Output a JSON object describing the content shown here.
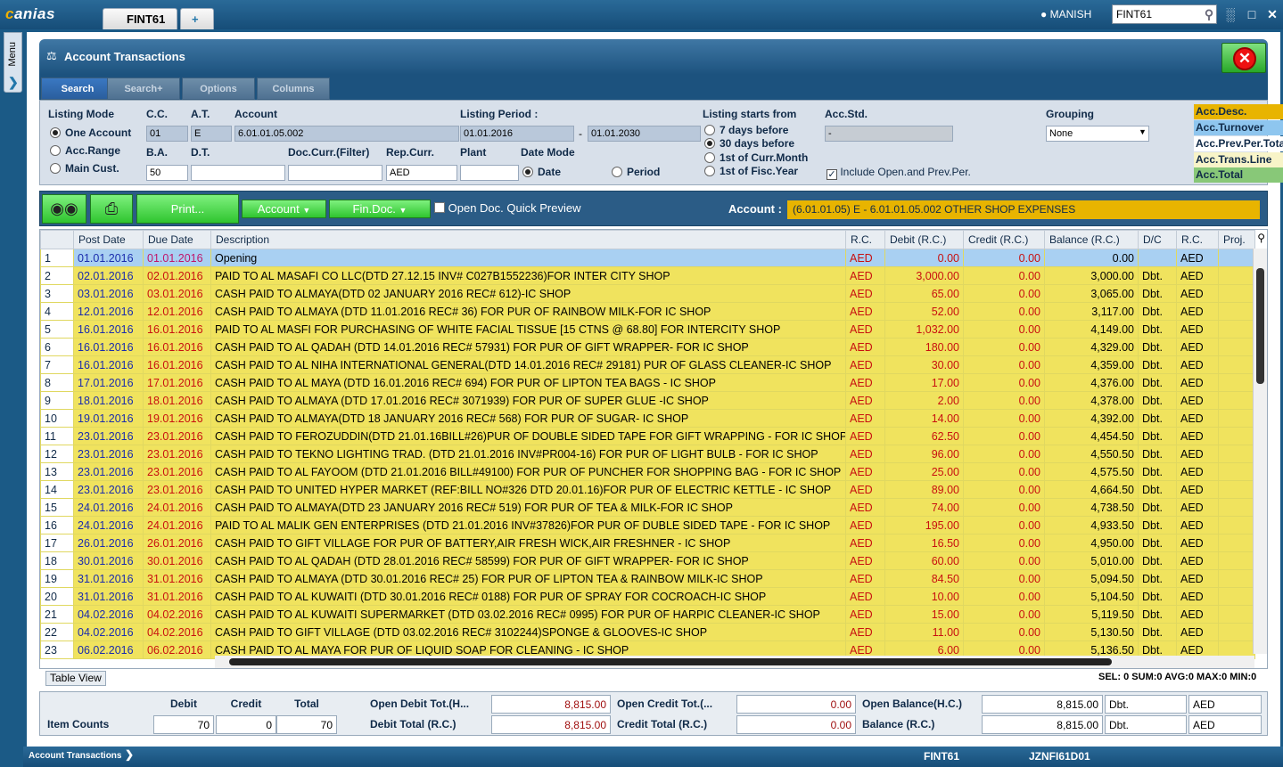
{
  "app": {
    "logo_prefix": "c",
    "logo_rest": "anias",
    "tab_title": "FINT61",
    "tab_new": "+",
    "user": "MANISH",
    "top_search_value": "FINT61"
  },
  "menu": {
    "label": "Menu"
  },
  "panel": {
    "title": "Account Transactions"
  },
  "subtabs": [
    "Search",
    "Search+",
    "Options",
    "Columns"
  ],
  "search": {
    "listing_mode_label": "Listing Mode",
    "radio_one_account": "One Account",
    "radio_acc_range": "Acc.Range",
    "radio_main_cust": "Main Cust.",
    "cc_label": "C.C.",
    "cc_value": "01",
    "at_label": "A.T.",
    "at_value": "E",
    "account_label": "Account",
    "account_value": "6.01.01.05.002",
    "listing_period_label": "Listing Period :",
    "period_from": "01.01.2016",
    "period_dash": "-",
    "period_to": "01.01.2030",
    "listing_starts_label": "Listing starts from",
    "ls_7": "7 days before",
    "ls_30": "30 days before",
    "ls_curr": "1st of Curr.Month",
    "ls_fisc": "1st of Fisc.Year",
    "accstd_label": "Acc.Std.",
    "accstd_value": "-",
    "grouping_label": "Grouping",
    "grouping_value": "None",
    "ba_label": "B.A.",
    "ba_value": "50",
    "dt_label": "D.T.",
    "doccurr_label": "Doc.Curr.(Filter)",
    "repcurr_label": "Rep.Curr.",
    "repcurr_value": "AED",
    "plant_label": "Plant",
    "datemode_label": "Date Mode",
    "dm_date": "Date",
    "dm_period": "Period",
    "include_label": "Include Open.and Prev.Per."
  },
  "legend": [
    {
      "label": "Acc.Desc.",
      "color": "#e8b400"
    },
    {
      "label": "Acc.Turnover",
      "color": "#8ec6ef"
    },
    {
      "label": "Acc.Prev.Per.Total",
      "color": "#ffffff"
    },
    {
      "label": "Acc.Trans.Line",
      "color": "#f8f4c8"
    },
    {
      "label": "Acc.Total",
      "color": "#88c878"
    }
  ],
  "toolbar": {
    "print_label": "Print...",
    "account_dd": "Account",
    "findoc_dd": "Fin.Doc.",
    "quick_preview": "Open Doc. Quick Preview",
    "account_label": "Account :",
    "account_info": "(6.01.01.05)  E - 6.01.01.05.002   OTHER SHOP EXPENSES"
  },
  "grid": {
    "columns": [
      "",
      "Post Date",
      "Due Date",
      "Description",
      "R.C.",
      "Debit (R.C.)",
      "Credit (R.C.)",
      "Balance (R.C.)",
      "D/C",
      "R.C.",
      "Proj."
    ],
    "rows": [
      [
        "1",
        "01.01.2016",
        "01.01.2016",
        "Opening",
        "AED",
        "0.00",
        "0.00",
        "0.00",
        "",
        "AED"
      ],
      [
        "2",
        "02.01.2016",
        "02.01.2016",
        "PAID TO AL MASAFI CO LLC(DTD 27.12.15 INV# C027B1552236)FOR INTER CITY SHOP",
        "AED",
        "3,000.00",
        "0.00",
        "3,000.00",
        "Dbt.",
        "AED"
      ],
      [
        "3",
        "03.01.2016",
        "03.01.2016",
        "CASH PAID TO ALMAYA(DTD 02 JANUARY 2016 REC# 612)-IC SHOP",
        "AED",
        "65.00",
        "0.00",
        "3,065.00",
        "Dbt.",
        "AED"
      ],
      [
        "4",
        "12.01.2016",
        "12.01.2016",
        "CASH PAID TO ALMAYA (DTD 11.01.2016 REC# 36) FOR PUR OF RAINBOW MILK-FOR IC SHOP",
        "AED",
        "52.00",
        "0.00",
        "3,117.00",
        "Dbt.",
        "AED"
      ],
      [
        "5",
        "16.01.2016",
        "16.01.2016",
        "PAID TO AL MASFI FOR PURCHASING OF WHITE FACIAL TISSUE  [15 CTNS @ 68.80] FOR INTERCITY SHOP",
        "AED",
        "1,032.00",
        "0.00",
        "4,149.00",
        "Dbt.",
        "AED"
      ],
      [
        "6",
        "16.01.2016",
        "16.01.2016",
        "CASH PAID TO AL QADAH (DTD 14.01.2016 REC# 57931) FOR PUR OF GIFT WRAPPER-  FOR IC SHOP",
        "AED",
        "180.00",
        "0.00",
        "4,329.00",
        "Dbt.",
        "AED"
      ],
      [
        "7",
        "16.01.2016",
        "16.01.2016",
        "CASH PAID TO AL NIHA INTERNATIONAL GENERAL(DTD 14.01.2016 REC# 29181) PUR OF GLASS CLEANER-IC SHOP",
        "AED",
        "30.00",
        "0.00",
        "4,359.00",
        "Dbt.",
        "AED"
      ],
      [
        "8",
        "17.01.2016",
        "17.01.2016",
        "CASH PAID TO AL MAYA (DTD 16.01.2016 REC# 694) FOR PUR OF LIPTON TEA BAGS - IC SHOP",
        "AED",
        "17.00",
        "0.00",
        "4,376.00",
        "Dbt.",
        "AED"
      ],
      [
        "9",
        "18.01.2016",
        "18.01.2016",
        "CASH PAID TO ALMAYA (DTD 17.01.2016 REC# 3071939) FOR PUR OF SUPER GLUE -IC SHOP",
        "AED",
        "2.00",
        "0.00",
        "4,378.00",
        "Dbt.",
        "AED"
      ],
      [
        "10",
        "19.01.2016",
        "19.01.2016",
        "CASH PAID TO ALMAYA(DTD 18 JANUARY 2016 REC# 568) FOR PUR OF SUGAR- IC SHOP",
        "AED",
        "14.00",
        "0.00",
        "4,392.00",
        "Dbt.",
        "AED"
      ],
      [
        "11",
        "23.01.2016",
        "23.01.2016",
        "CASH PAID TO FEROZUDDIN(DTD 21.01.16BILL#26)PUR OF DOUBLE SIDED TAPE FOR GIFT WRAPPING - FOR IC SHOP",
        "AED",
        "62.50",
        "0.00",
        "4,454.50",
        "Dbt.",
        "AED"
      ],
      [
        "12",
        "23.01.2016",
        "23.01.2016",
        "CASH PAID TO TEKNO LIGHTING TRAD. (DTD 21.01.2016 INV#PR004-16) FOR PUR OF LIGHT BULB - FOR IC SHOP",
        "AED",
        "96.00",
        "0.00",
        "4,550.50",
        "Dbt.",
        "AED"
      ],
      [
        "13",
        "23.01.2016",
        "23.01.2016",
        "CASH PAID TO AL FAYOOM (DTD 21.01.2016 BILL#49100) FOR PUR OF PUNCHER FOR SHOPPING BAG - FOR IC SHOP",
        "AED",
        "25.00",
        "0.00",
        "4,575.50",
        "Dbt.",
        "AED"
      ],
      [
        "14",
        "23.01.2016",
        "23.01.2016",
        "CASH PAID TO UNITED HYPER MARKET (REF:BILL NO#326 DTD 20.01.16)FOR PUR OF ELECTRIC KETTLE - IC SHOP",
        "AED",
        "89.00",
        "0.00",
        "4,664.50",
        "Dbt.",
        "AED"
      ],
      [
        "15",
        "24.01.2016",
        "24.01.2016",
        "CASH PAID TO ALMAYA(DTD 23 JANUARY 2016 REC# 519) FOR PUR OF TEA & MILK-FOR IC SHOP",
        "AED",
        "74.00",
        "0.00",
        "4,738.50",
        "Dbt.",
        "AED"
      ],
      [
        "16",
        "24.01.2016",
        "24.01.2016",
        "PAID TO AL MALIK GEN ENTERPRISES (DTD 21.01.2016 INV#37826)FOR PUR OF DUBLE SIDED TAPE - FOR IC SHOP",
        "AED",
        "195.00",
        "0.00",
        "4,933.50",
        "Dbt.",
        "AED"
      ],
      [
        "17",
        "26.01.2016",
        "26.01.2016",
        "CASH PAID TO GIFT VILLAGE FOR  PUR OF BATTERY,AIR FRESH WICK,AIR FRESHNER - IC SHOP",
        "AED",
        "16.50",
        "0.00",
        "4,950.00",
        "Dbt.",
        "AED"
      ],
      [
        "18",
        "30.01.2016",
        "30.01.2016",
        "CASH PAID TO AL QADAH (DTD 28.01.2016 REC# 58599) FOR PUR OF GIFT WRAPPER-  FOR IC SHOP",
        "AED",
        "60.00",
        "0.00",
        "5,010.00",
        "Dbt.",
        "AED"
      ],
      [
        "19",
        "31.01.2016",
        "31.01.2016",
        "CASH PAID TO ALMAYA (DTD 30.01.2016 REC# 25) FOR PUR OF LIPTON TEA &  RAINBOW MILK-IC SHOP",
        "AED",
        "84.50",
        "0.00",
        "5,094.50",
        "Dbt.",
        "AED"
      ],
      [
        "20",
        "31.01.2016",
        "31.01.2016",
        "CASH PAID TO AL KUWAITI (DTD 30.01.2016 REC# 0188) FOR PUR OF SPRAY FOR COCROACH-IC SHOP",
        "AED",
        "10.00",
        "0.00",
        "5,104.50",
        "Dbt.",
        "AED"
      ],
      [
        "21",
        "04.02.2016",
        "04.02.2016",
        "CASH PAID TO AL KUWAITI SUPERMARKET (DTD 03.02.2016 REC# 0995) FOR PUR OF HARPIC CLEANER-IC SHOP",
        "AED",
        "15.00",
        "0.00",
        "5,119.50",
        "Dbt.",
        "AED"
      ],
      [
        "22",
        "04.02.2016",
        "04.02.2016",
        "CASH PAID TO GIFT VILLAGE (DTD 03.02.2016 REC# 3102244)SPONGE & GLOOVES-IC SHOP",
        "AED",
        "11.00",
        "0.00",
        "5,130.50",
        "Dbt.",
        "AED"
      ],
      [
        "23",
        "06.02.2016",
        "06.02.2016",
        "CASH PAID TO AL MAYA FOR PUR OF LIQUID SOAP FOR CLEANING - IC SHOP",
        "AED",
        "6.00",
        "0.00",
        "5,136.50",
        "Dbt.",
        "AED"
      ]
    ]
  },
  "tableview_label": "Table View",
  "selinfo": "SEL: 0 SUM:0 AVG:0 MAX:0 MIN:0",
  "footer": {
    "debit_h": "Debit",
    "credit_h": "Credit",
    "total_h": "Total",
    "item_counts": "Item Counts",
    "debit_v": "70",
    "credit_v": "0",
    "total_v": "70",
    "open_debit_lbl": "Open Debit Tot.(H...",
    "open_debit_v": "8,815.00",
    "open_credit_lbl": "Open Credit Tot.(...",
    "open_credit_v": "0.00",
    "open_bal_lbl": "Open Balance(H.C.)",
    "open_bal_v": "8,815.00",
    "open_bal_dc": "Dbt.",
    "open_bal_cur": "AED",
    "debit_total_lbl": "Debit Total (R.C.)",
    "debit_total_v": "8,815.00",
    "credit_total_lbl": "Credit Total (R.C.)",
    "credit_total_v": "0.00",
    "bal_lbl": "Balance (R.C.)",
    "bal_v": "8,815.00",
    "bal_dc": "Dbt.",
    "bal_cur": "AED"
  },
  "status": {
    "left": "Account Transactions",
    "code1": "FINT61",
    "code2": "JZNFI61D01"
  }
}
